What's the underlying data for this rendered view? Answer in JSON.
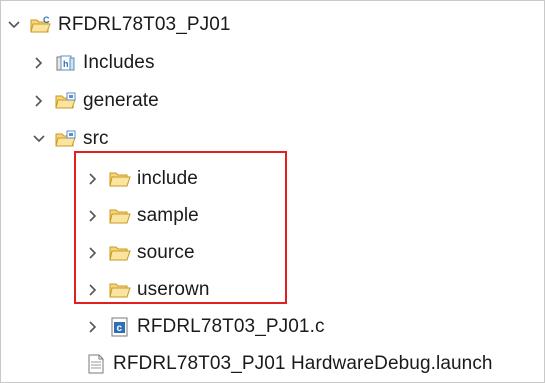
{
  "tree": {
    "project": {
      "label": "RFDRL78T03_PJ01",
      "expanded": true,
      "icon": "c-project-icon"
    },
    "includes": {
      "label": "Includes",
      "expanded": false,
      "icon": "includes-icon"
    },
    "generate": {
      "label": "generate",
      "expanded": false,
      "icon": "source-folder-icon"
    },
    "src": {
      "label": "src",
      "expanded": true,
      "icon": "source-folder-icon"
    },
    "folders": [
      {
        "label": "include",
        "expanded": false,
        "icon": "folder-icon"
      },
      {
        "label": "sample",
        "expanded": false,
        "icon": "folder-icon"
      },
      {
        "label": "source",
        "expanded": false,
        "icon": "folder-icon"
      },
      {
        "label": "userown",
        "expanded": false,
        "icon": "folder-icon"
      }
    ],
    "c_file": {
      "label": "RFDRL78T03_PJ01.c",
      "expanded": false,
      "icon": "c-file-icon"
    },
    "launch_file": {
      "label": "RFDRL78T03_PJ01 HardwareDebug.launch",
      "icon": "launch-file-icon"
    }
  },
  "colors": {
    "highlight_border": "#e02020",
    "folder_fill": "#f6d57e",
    "folder_stroke": "#c99a1f",
    "c_badge": "#2f6fb8"
  }
}
